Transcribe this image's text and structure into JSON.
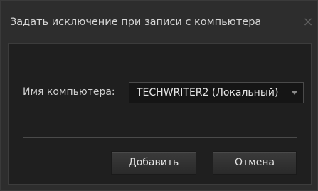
{
  "dialog": {
    "title": "Задать исключение при записи с компьютера",
    "close_icon": "×"
  },
  "form": {
    "computer_label": "Имя компьютера:",
    "computer_value": "TECHWRITER2 (Локальный)"
  },
  "buttons": {
    "add_label": "Добавить",
    "cancel_label": "Отмена"
  }
}
